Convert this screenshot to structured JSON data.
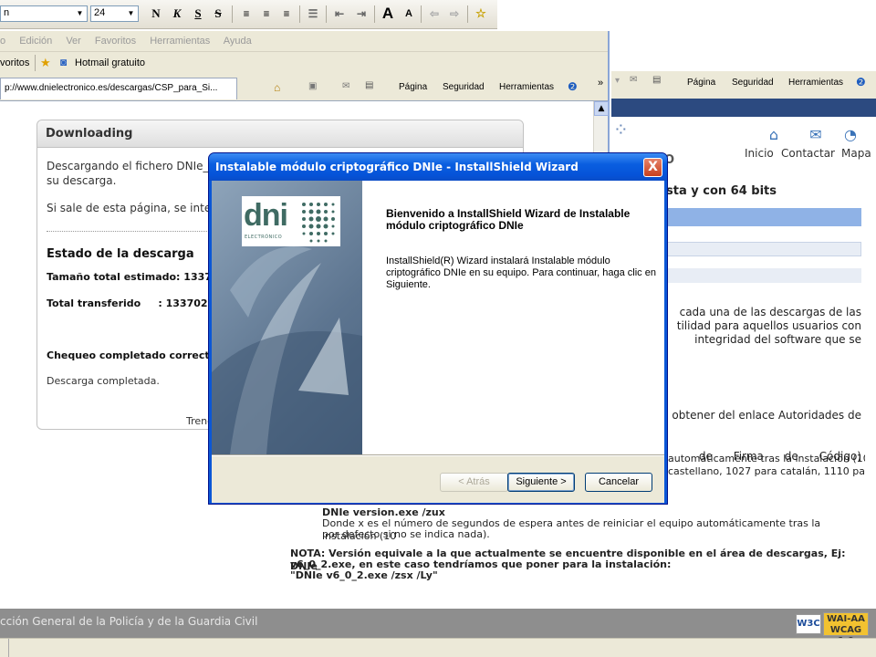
{
  "word_toolbar": {
    "font_name": "n",
    "font_size": "24",
    "bold": "N",
    "italic": "K",
    "underline": "S",
    "strike": "S",
    "grow_font": "A",
    "shrink_font": "A"
  },
  "ie": {
    "menu": [
      "o",
      "Edición",
      "Ver",
      "Favoritos",
      "Herramientas",
      "Ayuda"
    ],
    "favorites_label": "voritos",
    "hotmail_label": "Hotmail gratuito",
    "tab_url": "p://www.dnielectronico.es/descargas/CSP_para_Si...",
    "toolbar": {
      "page": "Página",
      "security": "Seguridad",
      "tools": "Herramientas"
    }
  },
  "download": {
    "header": "Downloading",
    "line1": "Descargando el fichero DNIe_V",
    "line2": "su descarga.",
    "line3": "Si sale de esta página, se inte",
    "status_title": "Estado de la descarga",
    "size_label": "Tamaño total estimado: 13370",
    "transferred_label": "Total transferido     : 1337023",
    "check": "Chequeo completado correctan",
    "complete": "Descarga completada.",
    "trend": "Trend"
  },
  "right_page": {
    "toolbar_page": "Página",
    "toolbar_security": "Seguridad",
    "toolbar_tools": "Herramientas",
    "nav": [
      "Inicio",
      "Contactar",
      "Mapa"
    ],
    "o_letter": "O",
    "heading": "sta y con 64 bits",
    "p1": [
      "cada una de las descargas de las",
      "tilidad para aquellos usuarios con",
      "integridad del software que se"
    ],
    "p2": [
      "obtener del enlace Autoridades de",
      "de      Firma      de      Código)"
    ],
    "p3": [
      "automáticamente tras la instalación (10",
      "castellano, 1027 para catalán, 1110 para"
    ]
  },
  "bottom": {
    "cmd": "DNIe version.exe /zux",
    "desc1": "Donde x es el número de segundos de espera antes de reiniciar el equipo automáticamente tras la instalación (10",
    "desc2": "por defecto si no se indica nada).",
    "note1": "NOTA: Versión equivale a la que actualmente se encuentre disponible en el área de descargas, Ej: DNIe",
    "note2": "v6_0_2.exe, en este caso tendríamos que poner para la instalación:",
    "note3": "\"DNIe v6_0_2.exe /zsx /Ly\""
  },
  "footer": {
    "text": "cción General de la Policía y de la Guardia Civil",
    "w3c": "W3C",
    "wai1": "WAI-AA",
    "wai2": "WCAG 1.0"
  },
  "dialog": {
    "title": "Instalable módulo criptográfico DNIe - InstallShield Wizard",
    "close": "X",
    "logo_text": "dni",
    "logo_sub": "ELECTRÓNICO",
    "welcome": "Bienvenido a InstallShield Wizard de Instalable módulo criptográfico DNIe",
    "body": "InstallShield(R) Wizard instalará Instalable módulo criptográfico DNIe en su equipo.  Para continuar, haga clic en Siguiente.",
    "back": "< Atrás",
    "next": "Siguiente >",
    "cancel": "Cancelar"
  },
  "colors": {
    "title_bar": "#0553d8",
    "dialog_face": "#ece9d8",
    "logo_green": "#3f6b63",
    "footer_gray": "#8e8e8e"
  }
}
